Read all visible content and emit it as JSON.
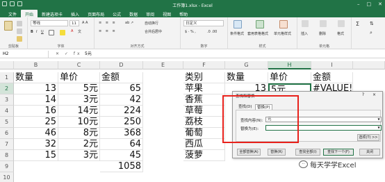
{
  "window": {
    "title": "工作簿1.xlsx - Excel"
  },
  "ribbon": {
    "tabs": [
      "文件",
      "开始",
      "新建选项卡",
      "插入",
      "页面布局",
      "公式",
      "数据",
      "审阅",
      "视图",
      "帮助"
    ],
    "active_tab": "开始",
    "font_name": "等线",
    "font_size": "11",
    "number_format": "日定义",
    "wrap_label": "自动换行",
    "merge_label": "合并后居中",
    "cond_format_label": "条件格式",
    "table_format_label": "套用表格格式",
    "cell_style_label": "单元格样式",
    "insert_label": "插入",
    "delete_label": "删除",
    "format_label": "格式",
    "groups": [
      "剪贴板",
      "字体",
      "对齐方式",
      "数字",
      "样式",
      "单元格"
    ]
  },
  "formula_bar": {
    "name_box": "H2",
    "value": "5元"
  },
  "grid": {
    "columns": [
      "B",
      "C",
      "D",
      "E",
      "F",
      "G",
      "H",
      "I"
    ],
    "selected_column": "H",
    "rows": [
      "1",
      "2",
      "3",
      "4",
      "5",
      "6",
      "7",
      "8",
      "9",
      "10"
    ],
    "selected_row": "2",
    "left_table": {
      "headers": [
        "数量",
        "单价",
        "金额"
      ],
      "data": [
        [
          "13",
          "5元",
          "65"
        ],
        [
          "14",
          "3元",
          "42"
        ],
        [
          "16",
          "14元",
          "224"
        ],
        [
          "25",
          "10元",
          "250"
        ],
        [
          "46",
          "8元",
          "368"
        ],
        [
          "32",
          "2元",
          "64"
        ],
        [
          "15",
          "3元",
          "45"
        ]
      ],
      "total": "1058"
    },
    "right_table": {
      "headers": [
        "类别",
        "数量",
        "单价",
        "金额"
      ],
      "categories": [
        "苹果",
        "香蕉",
        "草莓",
        "荔枝",
        "葡萄",
        "西瓜",
        "菠萝"
      ],
      "g2": "13",
      "h2": "5元",
      "i2": "#VALUE!"
    }
  },
  "dialog": {
    "title": "查找和替换",
    "help": "?",
    "close": "×",
    "tab_find": "查找(D)",
    "tab_replace": "替换(P)",
    "find_label": "查找内容(N):",
    "find_value": "元",
    "replace_label": "替换为(E):",
    "replace_value": "",
    "options_button": "选项(T) >>",
    "replace_all_button": "全部替换(A)",
    "replace_button": "替换(R)",
    "find_all_button": "查找全部(I)",
    "find_next_button": "查找下一个(F)",
    "close_button": "关闭"
  },
  "watermark": {
    "text": "每天学学Excel"
  },
  "colors": {
    "excel_green": "#217346",
    "highlight_red": "#e8211b"
  }
}
